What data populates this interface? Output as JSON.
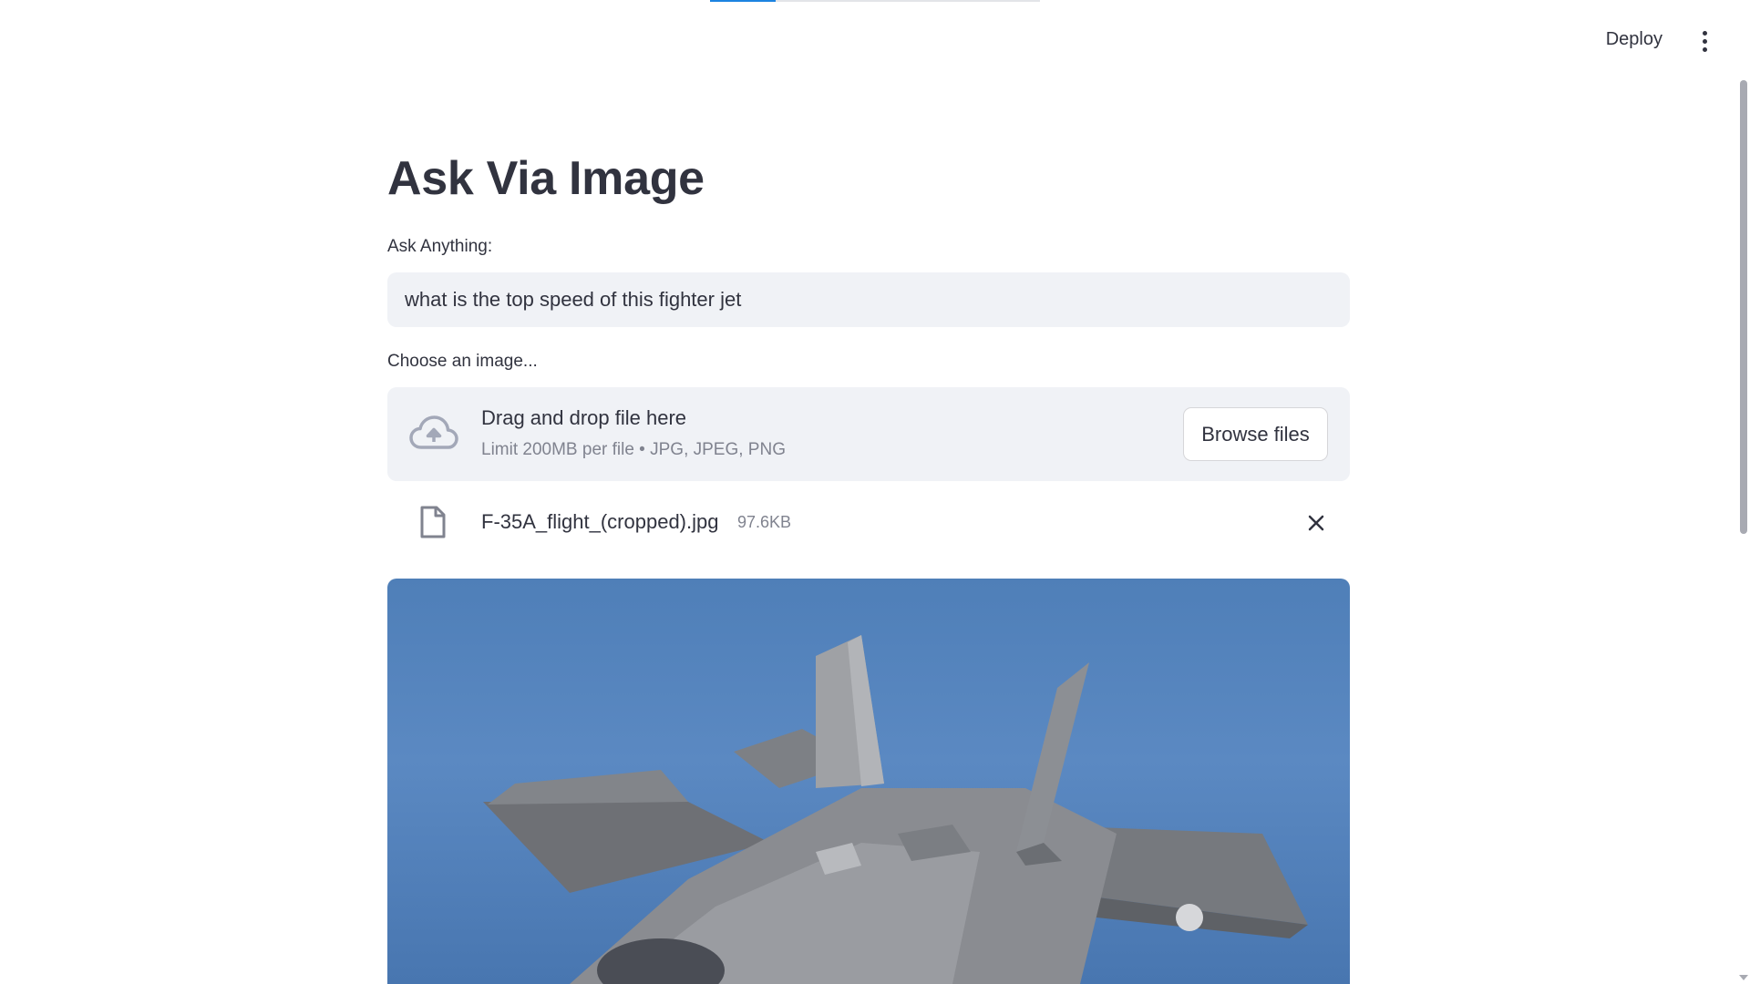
{
  "header": {
    "deploy_label": "Deploy",
    "menu_icon": "kebab-menu-icon"
  },
  "status": {
    "progress_fraction": 0.2
  },
  "main": {
    "title": "Ask Via Image",
    "question": {
      "label": "Ask Anything:",
      "value": "what is the top speed of this fighter jet"
    },
    "uploader": {
      "label": "Choose an image...",
      "dropzone_title": "Drag and drop file here",
      "dropzone_subtitle": "Limit 200MB per file • JPG, JPEG, PNG",
      "browse_label": "Browse files",
      "upload_icon": "cloud-upload-icon"
    },
    "uploaded_file": {
      "name": "F-35A_flight_(cropped).jpg",
      "size": "97.6KB",
      "file_icon": "file-icon",
      "remove_icon": "close-icon"
    },
    "image": {
      "subject": "F-35A fighter jet in flight against blue sky"
    }
  },
  "colors": {
    "accent": "#1c83e1",
    "input_bg": "#f0f2f6",
    "text": "#31333f",
    "muted_text": "#80838f",
    "sky": "#5b89c2"
  }
}
